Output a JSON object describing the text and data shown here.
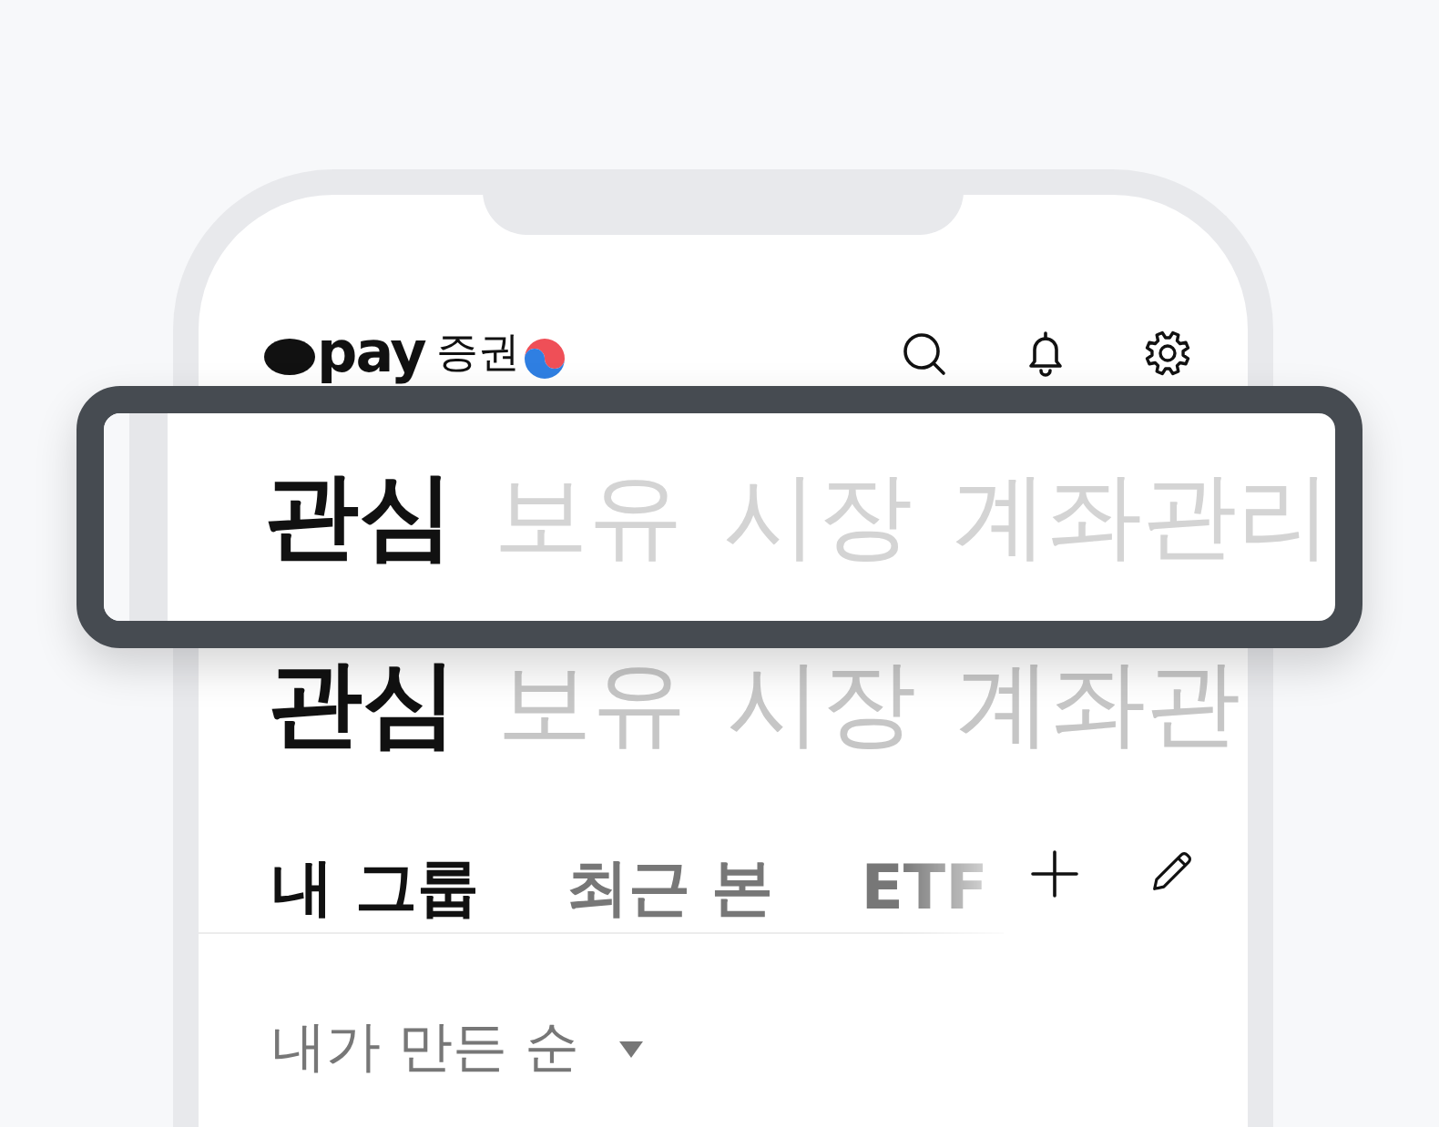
{
  "header": {
    "logo_text": "pay",
    "brand_label": "증권"
  },
  "magnified_tabs": [
    {
      "label": "관심",
      "selected": true
    },
    {
      "label": "보유",
      "selected": false
    },
    {
      "label": "시장",
      "selected": false
    },
    {
      "label": "계좌관리",
      "selected": false
    }
  ],
  "main_tabs": [
    {
      "label": "관심",
      "selected": true
    },
    {
      "label": "보유",
      "selected": false
    },
    {
      "label": "시장",
      "selected": false
    },
    {
      "label": "계좌관",
      "selected": false
    }
  ],
  "sub_tabs": [
    {
      "label": "내 그룹",
      "selected": true
    },
    {
      "label": "최근 본",
      "selected": false
    },
    {
      "label": "ETF",
      "selected": false
    }
  ],
  "sort": {
    "label": "내가 만든 순"
  }
}
